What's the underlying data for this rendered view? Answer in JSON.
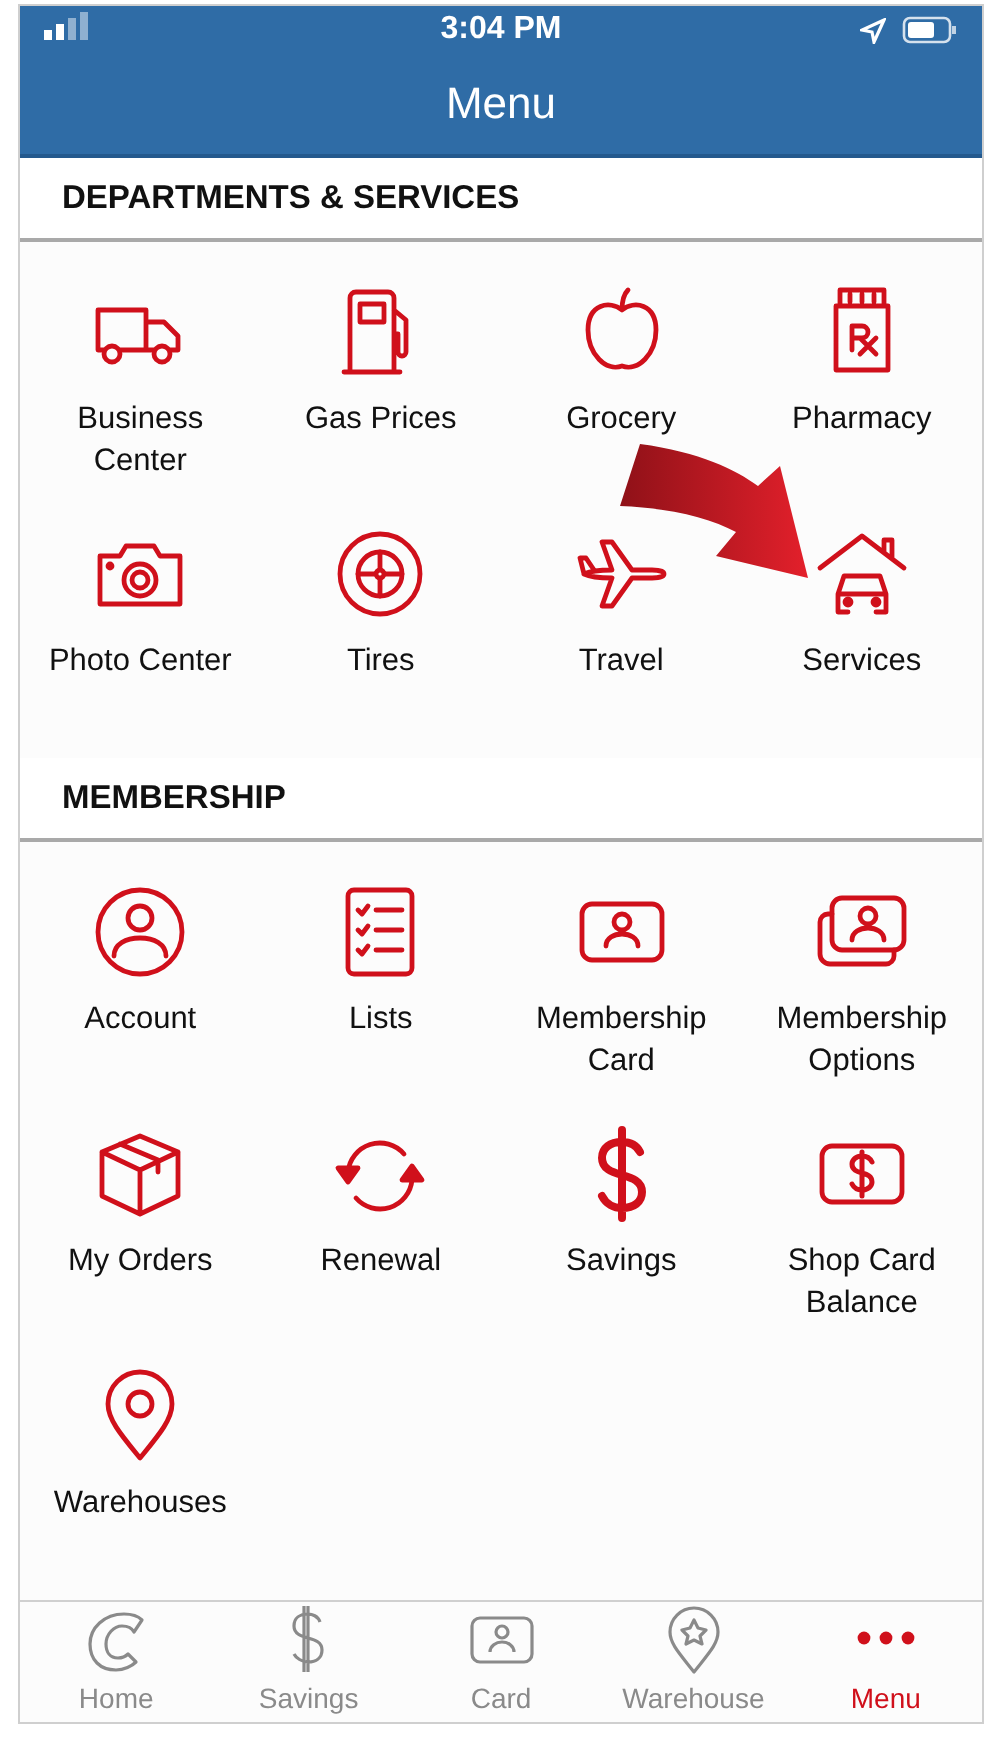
{
  "status_bar": {
    "time": "3:04 PM"
  },
  "nav": {
    "title": "Menu"
  },
  "sections": [
    {
      "title": "DEPARTMENTS & SERVICES",
      "items": [
        {
          "label": "Business Center"
        },
        {
          "label": "Gas Prices"
        },
        {
          "label": "Grocery"
        },
        {
          "label": "Pharmacy"
        },
        {
          "label": "Photo Center"
        },
        {
          "label": "Tires"
        },
        {
          "label": "Travel"
        },
        {
          "label": "Services"
        }
      ]
    },
    {
      "title": "MEMBERSHIP",
      "items": [
        {
          "label": "Account"
        },
        {
          "label": "Lists"
        },
        {
          "label": "Membership Card"
        },
        {
          "label": "Membership Options"
        },
        {
          "label": "My Orders"
        },
        {
          "label": "Renewal"
        },
        {
          "label": "Savings"
        },
        {
          "label": "Shop Card Balance"
        },
        {
          "label": "Warehouses"
        }
      ]
    }
  ],
  "tabs": [
    {
      "label": "Home",
      "selected": false
    },
    {
      "label": "Savings",
      "selected": false
    },
    {
      "label": "Card",
      "selected": false
    },
    {
      "label": "Warehouse",
      "selected": false
    },
    {
      "label": "Menu",
      "selected": true
    }
  ]
}
